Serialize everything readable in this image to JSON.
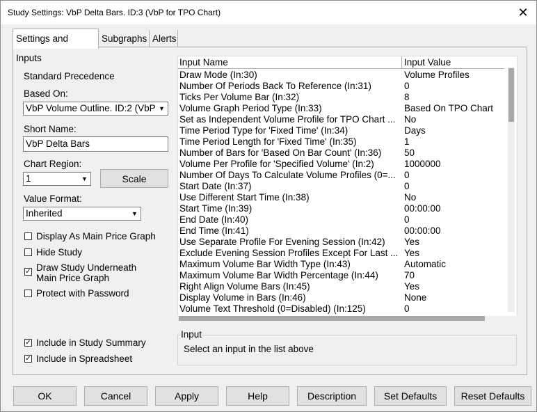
{
  "window": {
    "title": "Study Settings: VbP Delta Bars. ID:3 (VbP for TPO Chart)",
    "close_glyph": "✕"
  },
  "tabs": [
    {
      "label": "Settings and Inputs"
    },
    {
      "label": "Subgraphs"
    },
    {
      "label": "Alerts"
    }
  ],
  "left": {
    "precedence_label": "Standard Precedence",
    "based_on_label": "Based On:",
    "based_on_value": "VbP Volume Outline. ID:2 (VbP",
    "short_name_label": "Short Name:",
    "short_name_value": "VbP Delta Bars",
    "chart_region_label": "Chart Region:",
    "chart_region_value": "1",
    "scale_button": "Scale",
    "value_format_label": "Value Format:",
    "value_format_value": "Inherited",
    "checkboxes": [
      {
        "label": "Display As Main Price Graph",
        "checked": false
      },
      {
        "label": "Hide Study",
        "checked": false
      },
      {
        "label": "Draw Study Underneath",
        "label2": "Main Price Graph",
        "checked": true
      },
      {
        "label": "Protect with Password",
        "checked": false
      }
    ],
    "include_summary": {
      "label": "Include in Study Summary",
      "checked": true
    },
    "include_spreadsheet": {
      "label": "Include in Spreadsheet",
      "checked": true
    }
  },
  "inputs": {
    "col_name": "Input Name",
    "col_value": "Input Value",
    "rows": [
      {
        "name": "Draw Mode   (In:30)",
        "value": "Volume Profiles"
      },
      {
        "name": "Number Of Periods Back To Reference   (In:31)",
        "value": "0"
      },
      {
        "name": "Ticks Per Volume Bar   (In:32)",
        "value": "8"
      },
      {
        "name": "Volume Graph Period Type   (In:33)",
        "value": "Based On TPO Chart"
      },
      {
        "name": "Set as Independent Volume Profile for TPO Chart   ...",
        "value": "No"
      },
      {
        "name": "Time Period Type for 'Fixed Time'   (In:34)",
        "value": "Days"
      },
      {
        "name": "Time Period Length for 'Fixed Time'   (In:35)",
        "value": "1"
      },
      {
        "name": "Number of Bars for 'Based On Bar Count'   (In:36)",
        "value": "50"
      },
      {
        "name": "Volume Per Profile for 'Specified Volume'   (In:2)",
        "value": "1000000"
      },
      {
        "name": "Number Of Days To Calculate Volume Profiles (0=...",
        "value": "0"
      },
      {
        "name": "Start Date   (In:37)",
        "value": "0"
      },
      {
        "name": "Use Different Start Time   (In:38)",
        "value": "No"
      },
      {
        "name": "Start Time   (In:39)",
        "value": "00:00:00"
      },
      {
        "name": "End Date   (In:40)",
        "value": "0"
      },
      {
        "name": "End Time   (In:41)",
        "value": "00:00:00"
      },
      {
        "name": "Use Separate Profile For Evening Session   (In:42)",
        "value": "Yes"
      },
      {
        "name": "Exclude Evening Session Profiles Except For Last ...",
        "value": "Yes"
      },
      {
        "name": "Maximum Volume Bar Width Type   (In:43)",
        "value": "Automatic"
      },
      {
        "name": "Maximum Volume Bar Width Percentage   (In:44)",
        "value": "70"
      },
      {
        "name": "Right Align Volume Bars   (In:45)",
        "value": "Yes"
      },
      {
        "name": "Display Volume in Bars   (In:46)",
        "value": "None"
      },
      {
        "name": "Volume Text Threshold (0=Disabled)   (In:125)",
        "value": "0"
      }
    ]
  },
  "input_group": {
    "title": "Input",
    "text": "Select an input in the list above"
  },
  "buttons": {
    "ok": "OK",
    "cancel": "Cancel",
    "apply": "Apply",
    "help": "Help",
    "description": "Description",
    "set_defaults": "Set Defaults",
    "reset_defaults": "Reset Defaults"
  }
}
